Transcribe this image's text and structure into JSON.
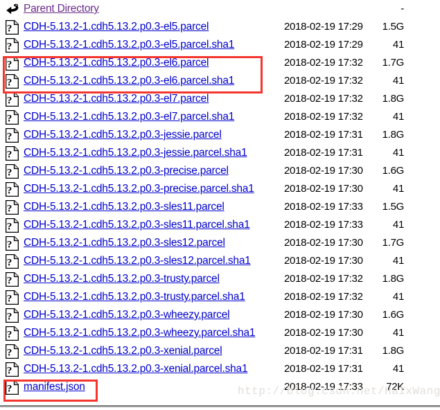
{
  "page": {
    "type": "apache-directory-index",
    "link_color": "#0000cd",
    "visited_link_color": "#6a2a8a",
    "highlight_color": "#f4352e"
  },
  "parent": {
    "icon": "go-back-icon",
    "label": "Parent Directory",
    "date": "",
    "size": "-"
  },
  "rows": [
    {
      "icon": "unknown-file-icon",
      "name": "CDH-5.13.2-1.cdh5.13.2.p0.3-el5.parcel",
      "date": "2018-02-19 17:29",
      "size": "1.5G"
    },
    {
      "icon": "unknown-file-icon",
      "name": "CDH-5.13.2-1.cdh5.13.2.p0.3-el5.parcel.sha1",
      "date": "2018-02-19 17:29",
      "size": "41"
    },
    {
      "icon": "unknown-file-icon",
      "name": "CDH-5.13.2-1.cdh5.13.2.p0.3-el6.parcel",
      "date": "2018-02-19 17:32",
      "size": "1.7G"
    },
    {
      "icon": "unknown-file-icon",
      "name": "CDH-5.13.2-1.cdh5.13.2.p0.3-el6.parcel.sha1",
      "date": "2018-02-19 17:32",
      "size": "41"
    },
    {
      "icon": "unknown-file-icon",
      "name": "CDH-5.13.2-1.cdh5.13.2.p0.3-el7.parcel",
      "date": "2018-02-19 17:32",
      "size": "1.8G"
    },
    {
      "icon": "unknown-file-icon",
      "name": "CDH-5.13.2-1.cdh5.13.2.p0.3-el7.parcel.sha1",
      "date": "2018-02-19 17:32",
      "size": "41"
    },
    {
      "icon": "unknown-file-icon",
      "name": "CDH-5.13.2-1.cdh5.13.2.p0.3-jessie.parcel",
      "date": "2018-02-19 17:31",
      "size": "1.8G"
    },
    {
      "icon": "unknown-file-icon",
      "name": "CDH-5.13.2-1.cdh5.13.2.p0.3-jessie.parcel.sha1",
      "date": "2018-02-19 17:31",
      "size": "41"
    },
    {
      "icon": "unknown-file-icon",
      "name": "CDH-5.13.2-1.cdh5.13.2.p0.3-precise.parcel",
      "date": "2018-02-19 17:30",
      "size": "1.6G"
    },
    {
      "icon": "unknown-file-icon",
      "name": "CDH-5.13.2-1.cdh5.13.2.p0.3-precise.parcel.sha1",
      "date": "2018-02-19 17:30",
      "size": "41"
    },
    {
      "icon": "unknown-file-icon",
      "name": "CDH-5.13.2-1.cdh5.13.2.p0.3-sles11.parcel",
      "date": "2018-02-19 17:33",
      "size": "1.5G"
    },
    {
      "icon": "unknown-file-icon",
      "name": "CDH-5.13.2-1.cdh5.13.2.p0.3-sles11.parcel.sha1",
      "date": "2018-02-19 17:33",
      "size": "41"
    },
    {
      "icon": "unknown-file-icon",
      "name": "CDH-5.13.2-1.cdh5.13.2.p0.3-sles12.parcel",
      "date": "2018-02-19 17:30",
      "size": "1.7G"
    },
    {
      "icon": "unknown-file-icon",
      "name": "CDH-5.13.2-1.cdh5.13.2.p0.3-sles12.parcel.sha1",
      "date": "2018-02-19 17:30",
      "size": "41"
    },
    {
      "icon": "unknown-file-icon",
      "name": "CDH-5.13.2-1.cdh5.13.2.p0.3-trusty.parcel",
      "date": "2018-02-19 17:32",
      "size": "1.8G"
    },
    {
      "icon": "unknown-file-icon",
      "name": "CDH-5.13.2-1.cdh5.13.2.p0.3-trusty.parcel.sha1",
      "date": "2018-02-19 17:32",
      "size": "41"
    },
    {
      "icon": "unknown-file-icon",
      "name": "CDH-5.13.2-1.cdh5.13.2.p0.3-wheezy.parcel",
      "date": "2018-02-19 17:30",
      "size": "1.6G"
    },
    {
      "icon": "unknown-file-icon",
      "name": "CDH-5.13.2-1.cdh5.13.2.p0.3-wheezy.parcel.sha1",
      "date": "2018-02-19 17:30",
      "size": "41"
    },
    {
      "icon": "unknown-file-icon",
      "name": "CDH-5.13.2-1.cdh5.13.2.p0.3-xenial.parcel",
      "date": "2018-02-19 17:31",
      "size": "1.8G"
    },
    {
      "icon": "unknown-file-icon",
      "name": "CDH-5.13.2-1.cdh5.13.2.p0.3-xenial.parcel.sha1",
      "date": "2018-02-19 17:31",
      "size": "41"
    },
    {
      "icon": "unknown-file-icon",
      "name": "manifest.json",
      "date": "2018-02-19 17:33",
      "size": "72K"
    }
  ],
  "annotations": {
    "highlight_el6_rows": [
      "CDH-5.13.2-1.cdh5.13.2.p0.3-el6.parcel",
      "CDH-5.13.2-1.cdh5.13.2.p0.3-el6.parcel.sha1"
    ],
    "highlight_manifest_row": "manifest.json"
  },
  "watermark": {
    "text": "http://blog.csdn.net/HaIxWang"
  }
}
